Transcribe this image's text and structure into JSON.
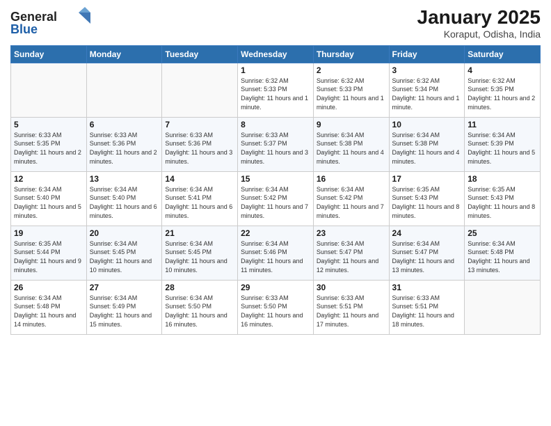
{
  "header": {
    "logo_general": "General",
    "logo_blue": "Blue",
    "month_title": "January 2025",
    "location": "Koraput, Odisha, India"
  },
  "weekdays": [
    "Sunday",
    "Monday",
    "Tuesday",
    "Wednesday",
    "Thursday",
    "Friday",
    "Saturday"
  ],
  "weeks": [
    [
      {
        "day": "",
        "sunrise": "",
        "sunset": "",
        "daylight": ""
      },
      {
        "day": "",
        "sunrise": "",
        "sunset": "",
        "daylight": ""
      },
      {
        "day": "",
        "sunrise": "",
        "sunset": "",
        "daylight": ""
      },
      {
        "day": "1",
        "sunrise": "Sunrise: 6:32 AM",
        "sunset": "Sunset: 5:33 PM",
        "daylight": "Daylight: 11 hours and 1 minute."
      },
      {
        "day": "2",
        "sunrise": "Sunrise: 6:32 AM",
        "sunset": "Sunset: 5:33 PM",
        "daylight": "Daylight: 11 hours and 1 minute."
      },
      {
        "day": "3",
        "sunrise": "Sunrise: 6:32 AM",
        "sunset": "Sunset: 5:34 PM",
        "daylight": "Daylight: 11 hours and 1 minute."
      },
      {
        "day": "4",
        "sunrise": "Sunrise: 6:32 AM",
        "sunset": "Sunset: 5:35 PM",
        "daylight": "Daylight: 11 hours and 2 minutes."
      }
    ],
    [
      {
        "day": "5",
        "sunrise": "Sunrise: 6:33 AM",
        "sunset": "Sunset: 5:35 PM",
        "daylight": "Daylight: 11 hours and 2 minutes."
      },
      {
        "day": "6",
        "sunrise": "Sunrise: 6:33 AM",
        "sunset": "Sunset: 5:36 PM",
        "daylight": "Daylight: 11 hours and 2 minutes."
      },
      {
        "day": "7",
        "sunrise": "Sunrise: 6:33 AM",
        "sunset": "Sunset: 5:36 PM",
        "daylight": "Daylight: 11 hours and 3 minutes."
      },
      {
        "day": "8",
        "sunrise": "Sunrise: 6:33 AM",
        "sunset": "Sunset: 5:37 PM",
        "daylight": "Daylight: 11 hours and 3 minutes."
      },
      {
        "day": "9",
        "sunrise": "Sunrise: 6:34 AM",
        "sunset": "Sunset: 5:38 PM",
        "daylight": "Daylight: 11 hours and 4 minutes."
      },
      {
        "day": "10",
        "sunrise": "Sunrise: 6:34 AM",
        "sunset": "Sunset: 5:38 PM",
        "daylight": "Daylight: 11 hours and 4 minutes."
      },
      {
        "day": "11",
        "sunrise": "Sunrise: 6:34 AM",
        "sunset": "Sunset: 5:39 PM",
        "daylight": "Daylight: 11 hours and 5 minutes."
      }
    ],
    [
      {
        "day": "12",
        "sunrise": "Sunrise: 6:34 AM",
        "sunset": "Sunset: 5:40 PM",
        "daylight": "Daylight: 11 hours and 5 minutes."
      },
      {
        "day": "13",
        "sunrise": "Sunrise: 6:34 AM",
        "sunset": "Sunset: 5:40 PM",
        "daylight": "Daylight: 11 hours and 6 minutes."
      },
      {
        "day": "14",
        "sunrise": "Sunrise: 6:34 AM",
        "sunset": "Sunset: 5:41 PM",
        "daylight": "Daylight: 11 hours and 6 minutes."
      },
      {
        "day": "15",
        "sunrise": "Sunrise: 6:34 AM",
        "sunset": "Sunset: 5:42 PM",
        "daylight": "Daylight: 11 hours and 7 minutes."
      },
      {
        "day": "16",
        "sunrise": "Sunrise: 6:34 AM",
        "sunset": "Sunset: 5:42 PM",
        "daylight": "Daylight: 11 hours and 7 minutes."
      },
      {
        "day": "17",
        "sunrise": "Sunrise: 6:35 AM",
        "sunset": "Sunset: 5:43 PM",
        "daylight": "Daylight: 11 hours and 8 minutes."
      },
      {
        "day": "18",
        "sunrise": "Sunrise: 6:35 AM",
        "sunset": "Sunset: 5:43 PM",
        "daylight": "Daylight: 11 hours and 8 minutes."
      }
    ],
    [
      {
        "day": "19",
        "sunrise": "Sunrise: 6:35 AM",
        "sunset": "Sunset: 5:44 PM",
        "daylight": "Daylight: 11 hours and 9 minutes."
      },
      {
        "day": "20",
        "sunrise": "Sunrise: 6:34 AM",
        "sunset": "Sunset: 5:45 PM",
        "daylight": "Daylight: 11 hours and 10 minutes."
      },
      {
        "day": "21",
        "sunrise": "Sunrise: 6:34 AM",
        "sunset": "Sunset: 5:45 PM",
        "daylight": "Daylight: 11 hours and 10 minutes."
      },
      {
        "day": "22",
        "sunrise": "Sunrise: 6:34 AM",
        "sunset": "Sunset: 5:46 PM",
        "daylight": "Daylight: 11 hours and 11 minutes."
      },
      {
        "day": "23",
        "sunrise": "Sunrise: 6:34 AM",
        "sunset": "Sunset: 5:47 PM",
        "daylight": "Daylight: 11 hours and 12 minutes."
      },
      {
        "day": "24",
        "sunrise": "Sunrise: 6:34 AM",
        "sunset": "Sunset: 5:47 PM",
        "daylight": "Daylight: 11 hours and 13 minutes."
      },
      {
        "day": "25",
        "sunrise": "Sunrise: 6:34 AM",
        "sunset": "Sunset: 5:48 PM",
        "daylight": "Daylight: 11 hours and 13 minutes."
      }
    ],
    [
      {
        "day": "26",
        "sunrise": "Sunrise: 6:34 AM",
        "sunset": "Sunset: 5:48 PM",
        "daylight": "Daylight: 11 hours and 14 minutes."
      },
      {
        "day": "27",
        "sunrise": "Sunrise: 6:34 AM",
        "sunset": "Sunset: 5:49 PM",
        "daylight": "Daylight: 11 hours and 15 minutes."
      },
      {
        "day": "28",
        "sunrise": "Sunrise: 6:34 AM",
        "sunset": "Sunset: 5:50 PM",
        "daylight": "Daylight: 11 hours and 16 minutes."
      },
      {
        "day": "29",
        "sunrise": "Sunrise: 6:33 AM",
        "sunset": "Sunset: 5:50 PM",
        "daylight": "Daylight: 11 hours and 16 minutes."
      },
      {
        "day": "30",
        "sunrise": "Sunrise: 6:33 AM",
        "sunset": "Sunset: 5:51 PM",
        "daylight": "Daylight: 11 hours and 17 minutes."
      },
      {
        "day": "31",
        "sunrise": "Sunrise: 6:33 AM",
        "sunset": "Sunset: 5:51 PM",
        "daylight": "Daylight: 11 hours and 18 minutes."
      },
      {
        "day": "",
        "sunrise": "",
        "sunset": "",
        "daylight": ""
      }
    ]
  ]
}
